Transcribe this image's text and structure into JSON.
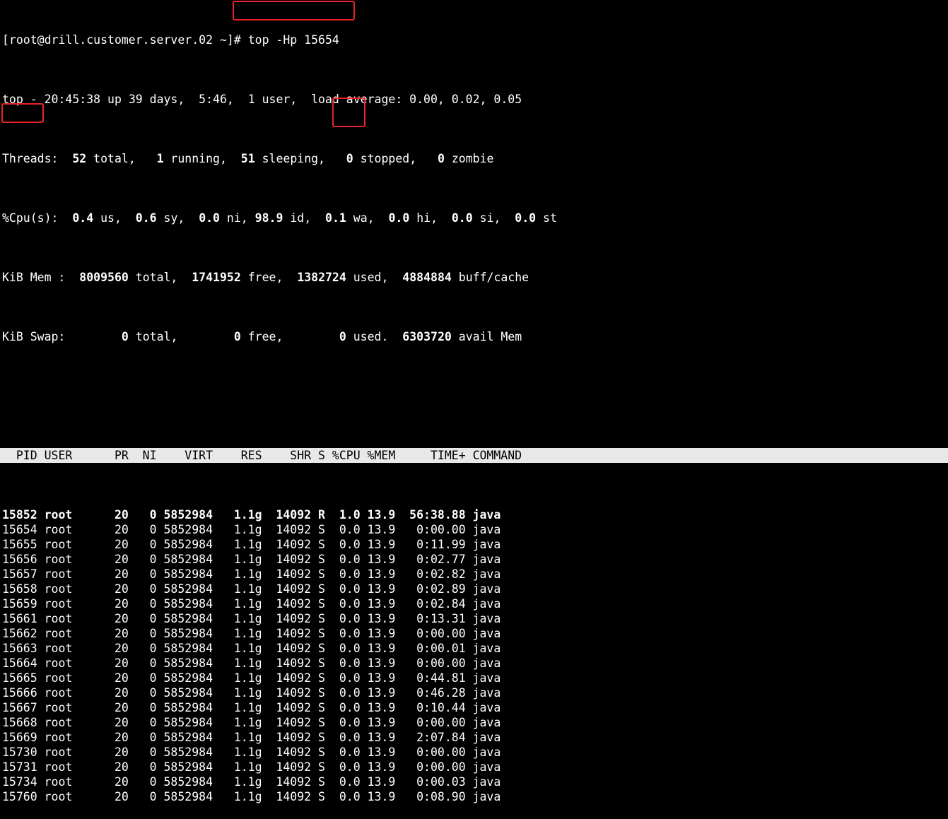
{
  "prompt": {
    "user_host": "[root@drill.customer.server.02 ~]",
    "command": "# top -Hp 15654"
  },
  "summary": {
    "top": {
      "prefix": "top - ",
      "time": "20:45:38",
      "uptime": " up 39 days,  5:46,  1 user,  load average: 0.00, 0.02, 0.05"
    },
    "threads": {
      "label": "Threads:  ",
      "total": "52",
      "total_label": " total,   ",
      "running": "1",
      "running_label": " running,  ",
      "sleeping": "51",
      "sleeping_label": " sleeping,   ",
      "stopped": "0",
      "stopped_label": " stopped,   ",
      "zombie": "0",
      "zombie_label": " zombie"
    },
    "cpu": {
      "label": "%Cpu(s):  ",
      "us": "0.4",
      "us_label": " us,  ",
      "sy": "0.6",
      "sy_label": " sy,  ",
      "ni": "0.0",
      "ni_label": " ni, ",
      "id": "98.9",
      "id_label": " id,  ",
      "wa": "0.1",
      "wa_label": " wa,  ",
      "hi": "0.0",
      "hi_label": " hi,  ",
      "si": "0.0",
      "si_label": " si,  ",
      "st": "0.0",
      "st_label": " st"
    },
    "mem": {
      "label": "KiB Mem :  ",
      "total": "8009560",
      "total_label": " total,  ",
      "free": "1741952",
      "free_label": " free,  ",
      "used": "1382724",
      "used_label": " used,  ",
      "cache": "4884884",
      "cache_label": " buff/cache"
    },
    "swap": {
      "label": "KiB Swap:        ",
      "total": "0",
      "total_label": " total,        ",
      "free": "0",
      "free_label": " free,        ",
      "used": "0",
      "used_label": " used.  ",
      "avail": "6303720",
      "avail_label": " avail Mem"
    }
  },
  "table": {
    "header": "  PID USER      PR  NI    VIRT    RES    SHR S %CPU %MEM     TIME+ COMMAND",
    "rows": [
      "15852 root      20   0 5852984   1.1g  14092 R  1.0 13.9  56:38.88 java",
      "15654 root      20   0 5852984   1.1g  14092 S  0.0 13.9   0:00.00 java",
      "15655 root      20   0 5852984   1.1g  14092 S  0.0 13.9   0:11.99 java",
      "15656 root      20   0 5852984   1.1g  14092 S  0.0 13.9   0:02.77 java",
      "15657 root      20   0 5852984   1.1g  14092 S  0.0 13.9   0:02.82 java",
      "15658 root      20   0 5852984   1.1g  14092 S  0.0 13.9   0:02.89 java",
      "15659 root      20   0 5852984   1.1g  14092 S  0.0 13.9   0:02.84 java",
      "15661 root      20   0 5852984   1.1g  14092 S  0.0 13.9   0:13.31 java",
      "15662 root      20   0 5852984   1.1g  14092 S  0.0 13.9   0:00.00 java",
      "15663 root      20   0 5852984   1.1g  14092 S  0.0 13.9   0:00.01 java",
      "15664 root      20   0 5852984   1.1g  14092 S  0.0 13.9   0:00.00 java",
      "15665 root      20   0 5852984   1.1g  14092 S  0.0 13.9   0:44.81 java",
      "15666 root      20   0 5852984   1.1g  14092 S  0.0 13.9   0:46.28 java",
      "15667 root      20   0 5852984   1.1g  14092 S  0.0 13.9   0:10.44 java",
      "15668 root      20   0 5852984   1.1g  14092 S  0.0 13.9   0:00.00 java",
      "15669 root      20   0 5852984   1.1g  14092 S  0.0 13.9   2:07.84 java",
      "15730 root      20   0 5852984   1.1g  14092 S  0.0 13.9   0:00.00 java",
      "15731 root      20   0 5852984   1.1g  14092 S  0.0 13.9   0:00.00 java",
      "15734 root      20   0 5852984   1.1g  14092 S  0.0 13.9   0:00.03 java",
      "15760 root      20   0 5852984   1.1g  14092 S  0.0 13.9   0:08.90 java"
    ]
  },
  "colors": {
    "background": "#000000",
    "text": "#ffffff",
    "header_bg": "#e8e8e8",
    "highlight": "#e8232a"
  }
}
